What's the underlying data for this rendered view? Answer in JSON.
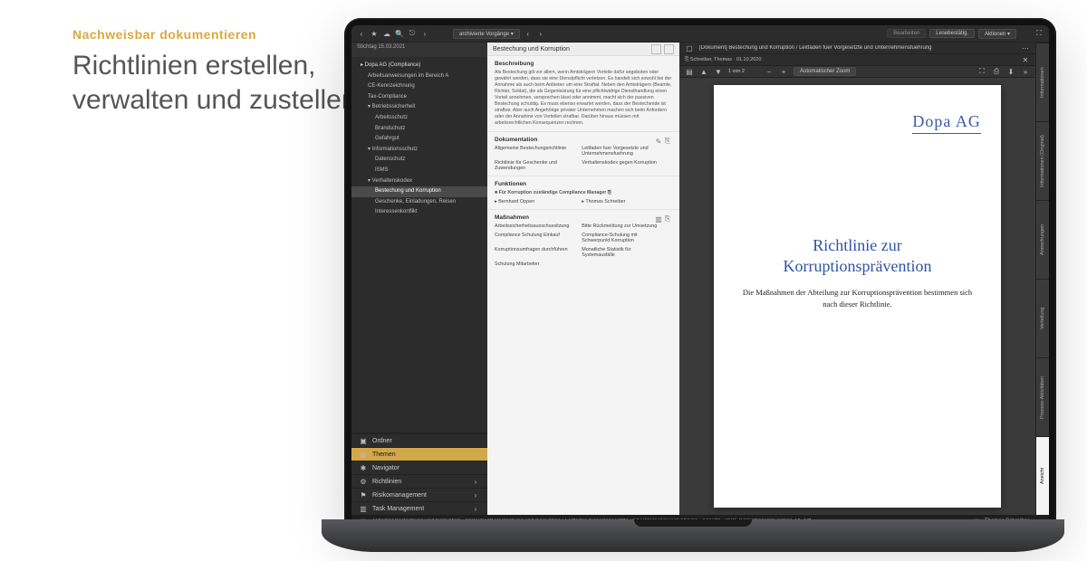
{
  "copy": {
    "eyebrow": "Nachweisbar dokumentieren",
    "headline": "Richtlinien erstellen, verwalten und zustellen"
  },
  "topbar": {
    "archive_chip": "archivierte Vorgänge  ▾",
    "btn_bearbeiten": "Bearbeiten",
    "btn_lesebest": "Lesebestätig.",
    "btn_aktionen": "Aktionen  ▾"
  },
  "sidebar": {
    "date": "Stichtag 15.03.2021",
    "tree": [
      {
        "l": 1,
        "t": "▸ Dopa AG (Compliance)"
      },
      {
        "l": 2,
        "t": "Arbeitsanweisungen im Bereich A"
      },
      {
        "l": 2,
        "t": "CE-Kennzeichnung"
      },
      {
        "l": 2,
        "t": "Tax-Compliance"
      },
      {
        "l": 2,
        "t": "▾ Betriebssicherheit"
      },
      {
        "l": 3,
        "t": "Arbeitsschutz"
      },
      {
        "l": 3,
        "t": "Brandschutz"
      },
      {
        "l": 3,
        "t": "Gefahrgut"
      },
      {
        "l": 2,
        "t": "▾ Informationsschutz"
      },
      {
        "l": 3,
        "t": "Datenschutz"
      },
      {
        "l": 3,
        "t": "ISMS"
      },
      {
        "l": 2,
        "t": "▾ Verhaltenskodex"
      },
      {
        "l": 3,
        "t": "Bestechung und Korruption",
        "sel": true
      },
      {
        "l": 3,
        "t": "Geschenke, Einladungen, Reisen"
      },
      {
        "l": 3,
        "t": "Interessenkonflikt"
      }
    ],
    "footer": [
      {
        "icon": "folder",
        "label": "Ordner"
      },
      {
        "icon": "themes",
        "label": "Themen",
        "active": true
      },
      {
        "icon": "nav",
        "label": "Navigator"
      },
      {
        "icon": "rules",
        "label": "Richtlinien"
      },
      {
        "icon": "risk",
        "label": "Risikomanagement"
      },
      {
        "icon": "task",
        "label": "Task Management"
      }
    ]
  },
  "center": {
    "title": "Bestechung und Korruption",
    "beschreibung_h": "Beschreibung",
    "beschreibung": "Als Bestechung gilt vor allem, wenn Amtsträgern Vorteile dafür angeboten oder gewährt werden, dass sie eine Dienstpflicht verletzen. Es handelt sich sowohl bei der Annahme als auch beim Anbieten um eine Straftat. Neben den Amtsträgern (Beamte, Richter, Soldat), die als Gegenleistung für eine pflichtwidrige Diensthandlung einen Vorteil annehmen, versprechen lässt oder annimmt, macht sich der passiven Bestechung schuldig. Es muss ebenso erwartet werden, dass der Bestechende ist strafbar. Aber auch Angehörige privater Unternehmen machen sich beim Anfordern oder der Annahme von Vorteilen strafbar. Darüber hinaus müssen mit arbeitsrechtlichen Konsequenzen rechnen.",
    "dokumentation_h": "Dokumentation",
    "dokumentation_items": [
      "Allgemeine Bestechungsrichtlinie",
      "Leitfaden fuer Vorgesetzte und Unternehmensfuehrung",
      "Richtlinie für Geschenke und Zuwendungen",
      "Verhaltenskodex gegen Korruption"
    ],
    "funktionen_h": "Funktionen",
    "funktionen_group": "Für Korruption zuständige Compliance Manager",
    "funktionen_people": [
      "Bernhard Oppen",
      "Thomas Schreiber"
    ],
    "massnahmen_h": "Maßnahmen",
    "massnahmen_items": [
      "Arbeitssicherheitsausschussitzung",
      "Bitte Rückmeldung zur Umsetzung",
      "Compliance Schulung Einkauf",
      "Compliance-Schulung mit Schwerpunkt Korruption",
      "Korruptionsumfragen durchführen",
      "Monatliche Statistik für Systemausfälle",
      "Schulung Mitarbeiter"
    ]
  },
  "doc": {
    "title": "[Dokument] Bestechung und Korruption / Leitfaden fuer Vorgesetzte und Unternehmensfuehrung",
    "meta": "⎘ Schreiber, Thomas · 01.10.2020",
    "pdf_page": "1  von 2",
    "pdf_zoom": "Automatischer Zoom",
    "brand": "Dopa AG",
    "ptitle": "Richtlinie zur Korruptionsprävention",
    "psub": "Die Maßnahmen der Abteilung zur Korruptionsprävention bestimmen sich nach dieser Richtlinie."
  },
  "right_tabs": [
    "Informationen",
    "Informationen (Original)",
    "Anmerkungen",
    "Verteilung",
    "Prozess-Aktivitäten",
    "Ansicht"
  ],
  "right_tab_active": 5,
  "status": {
    "crumbs": "[Thema] Bestechung und Korruption  ›  [Dokument] Bestechung und Korruption / Leitfaden fuer Vorgesetzte und Unternehmensfuehrung  ›  Ansicht  ›  PUB_Korruptionsprävention_V5.pdf",
    "user": "Thomas Schreiber"
  }
}
